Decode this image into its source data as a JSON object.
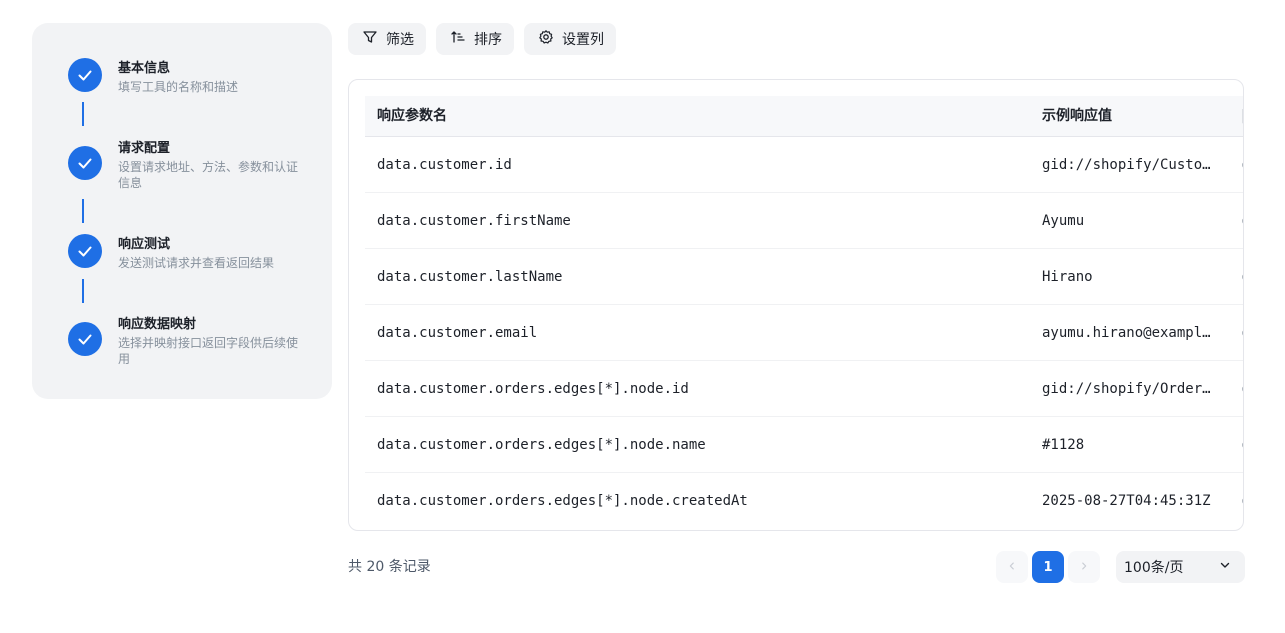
{
  "steps": [
    {
      "title": "基本信息",
      "desc": "填写工具的名称和描述",
      "status": "done"
    },
    {
      "title": "请求配置",
      "desc": "设置请求地址、方法、参数和认证信息",
      "status": "done"
    },
    {
      "title": "响应测试",
      "desc": "发送测试请求并查看返回结果",
      "status": "done"
    },
    {
      "title": "响应数据映射",
      "desc": "选择并映射接口返回字段供后续使用",
      "status": "done"
    }
  ],
  "toolbar": {
    "filter_label": "筛选",
    "sort_label": "排序",
    "columns_label": "设置列"
  },
  "table": {
    "columns": [
      "响应参数名",
      "示例响应值"
    ],
    "rows": [
      {
        "name": "data.customer.id",
        "example": "gid://shopify/Customer/..."
      },
      {
        "name": "data.customer.firstName",
        "example": "Ayumu"
      },
      {
        "name": "data.customer.lastName",
        "example": "Hirano"
      },
      {
        "name": "data.customer.email",
        "example": "ayumu.hirano@example.com"
      },
      {
        "name": "data.customer.orders.edges[*].node.id",
        "example": "gid://shopify/Order/..."
      },
      {
        "name": "data.customer.orders.edges[*].node.name",
        "example": "#1128"
      },
      {
        "name": "data.customer.orders.edges[*].node.createdAt",
        "example": "2025-08-27T04:45:31Z"
      }
    ]
  },
  "footer": {
    "total_text": "共 20 条记录",
    "current_page": "1",
    "page_size": "100条/页"
  },
  "colors": {
    "accent": "#1f6fe5",
    "panel_bg": "#f2f3f5"
  }
}
